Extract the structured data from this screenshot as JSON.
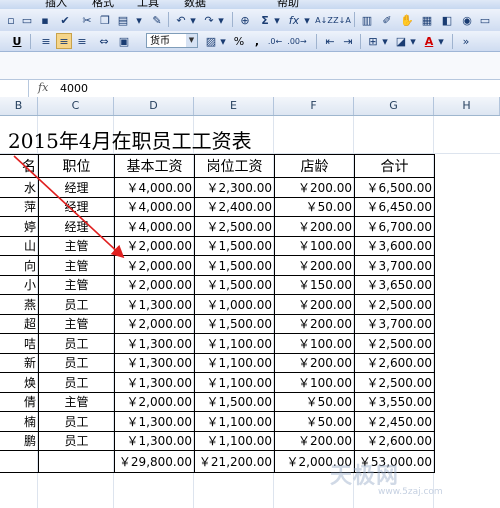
{
  "menu": [
    "插入",
    "格式",
    "工具",
    "数据",
    "帮助"
  ],
  "toolbar": {
    "underline_label": "U",
    "font_color": "A",
    "sigma": "Σ",
    "fx": "fx",
    "sort_az": "A↓Z",
    "sort_za": "Z↓A",
    "currency_dropdown": "货币",
    "percent": "%",
    "comma": ",",
    "fill_color_label": "A"
  },
  "formula_bar": {
    "fx_label": "fx",
    "value": "4000"
  },
  "columns": [
    "B",
    "C",
    "D",
    "E",
    "F",
    "G",
    "H"
  ],
  "sheet": {
    "title": "2015年4月在职员工工资表",
    "headers": [
      "名",
      "职位",
      "基本工资",
      "岗位工资",
      "店龄",
      "合计"
    ],
    "rows": [
      {
        "name": "水",
        "position": "经理",
        "base": "￥4,000.00",
        "post": "￥2,300.00",
        "tenure": "￥200.00",
        "total": "￥6,500.00"
      },
      {
        "name": "萍",
        "position": "经理",
        "base": "￥4,000.00",
        "post": "￥2,400.00",
        "tenure": "￥50.00",
        "total": "￥6,450.00"
      },
      {
        "name": "婷",
        "position": "经理",
        "base": "￥4,000.00",
        "post": "￥2,500.00",
        "tenure": "￥200.00",
        "total": "￥6,700.00"
      },
      {
        "name": "山",
        "position": "主管",
        "base": "￥2,000.00",
        "post": "￥1,500.00",
        "tenure": "￥100.00",
        "total": "￥3,600.00"
      },
      {
        "name": "向",
        "position": "主管",
        "base": "￥2,000.00",
        "post": "￥1,500.00",
        "tenure": "￥200.00",
        "total": "￥3,700.00"
      },
      {
        "name": "小",
        "position": "主管",
        "base": "￥2,000.00",
        "post": "￥1,500.00",
        "tenure": "￥150.00",
        "total": "￥3,650.00"
      },
      {
        "name": "燕",
        "position": "员工",
        "base": "￥1,300.00",
        "post": "￥1,000.00",
        "tenure": "￥200.00",
        "total": "￥2,500.00"
      },
      {
        "name": "超",
        "position": "主管",
        "base": "￥2,000.00",
        "post": "￥1,500.00",
        "tenure": "￥200.00",
        "total": "￥3,700.00"
      },
      {
        "name": "咭",
        "position": "员工",
        "base": "￥1,300.00",
        "post": "￥1,100.00",
        "tenure": "￥100.00",
        "total": "￥2,500.00"
      },
      {
        "name": "新",
        "position": "员工",
        "base": "￥1,300.00",
        "post": "￥1,100.00",
        "tenure": "￥200.00",
        "total": "￥2,600.00"
      },
      {
        "name": "焕",
        "position": "员工",
        "base": "￥1,300.00",
        "post": "￥1,100.00",
        "tenure": "￥100.00",
        "total": "￥2,500.00"
      },
      {
        "name": "倩",
        "position": "主管",
        "base": "￥2,000.00",
        "post": "￥1,500.00",
        "tenure": "￥50.00",
        "total": "￥3,550.00"
      },
      {
        "name": "楠",
        "position": "员工",
        "base": "￥1,300.00",
        "post": "￥1,100.00",
        "tenure": "￥50.00",
        "total": "￥2,450.00"
      },
      {
        "name": "鹏",
        "position": "员工",
        "base": "￥1,300.00",
        "post": "￥1,100.00",
        "tenure": "￥200.00",
        "total": "￥2,600.00"
      }
    ],
    "totals": {
      "base": "￥29,800.00",
      "post": "￥21,200.00",
      "tenure": "￥2,000.00",
      "total": "￥53,000.00"
    }
  },
  "watermark": {
    "text": "天极网",
    "url": "www.5zaj.com"
  },
  "colors": {
    "arrow": "#e02020",
    "grid": "#dde4ee",
    "toolbar": "#cfdcf1"
  }
}
